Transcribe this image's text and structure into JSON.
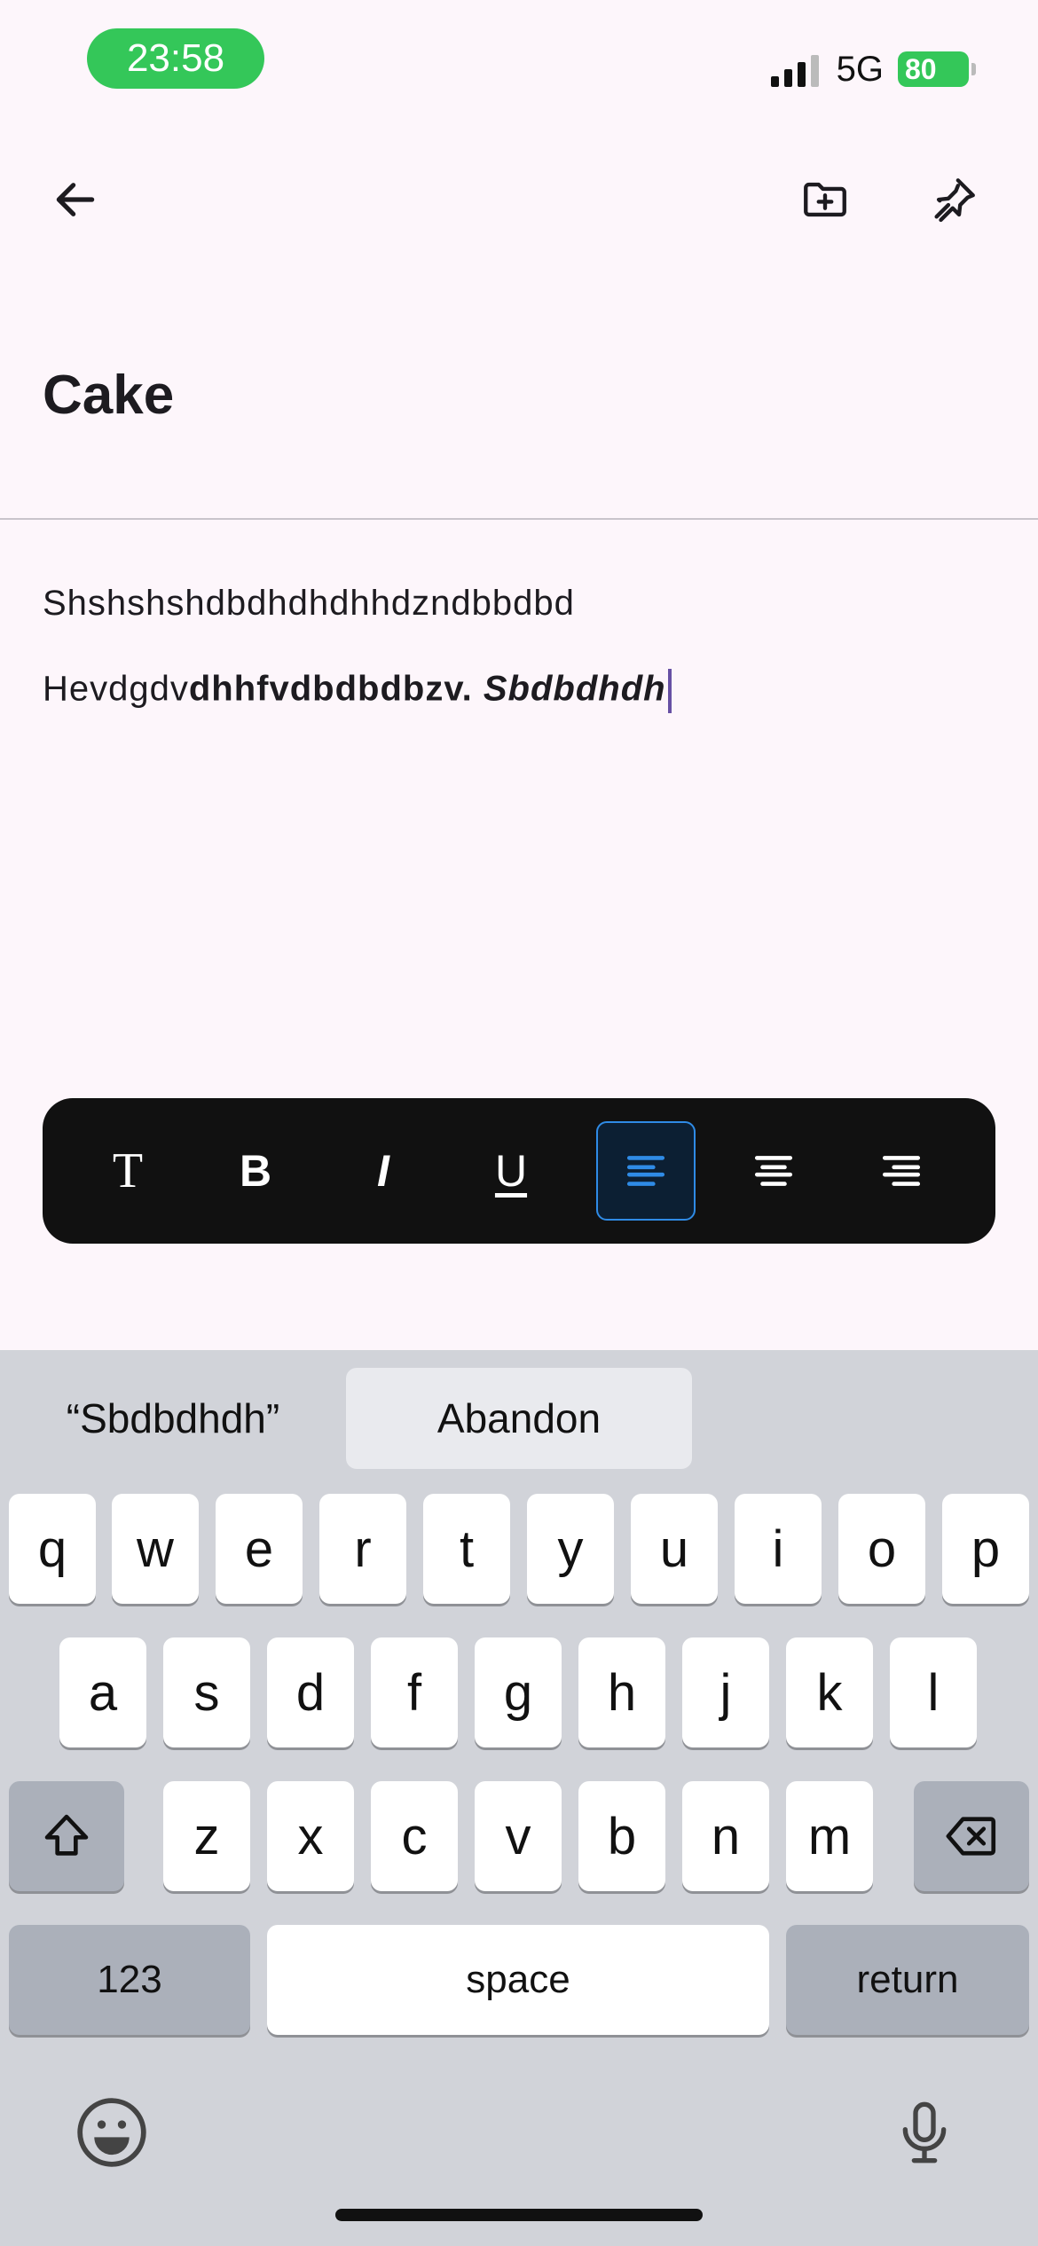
{
  "status_bar": {
    "time": "23:58",
    "network": "5G",
    "battery": "80"
  },
  "note": {
    "title": "Cake",
    "line1": "Shshshshdbdhdhdhhdzndbbdbd",
    "line2_regular": "Hevdgdv",
    "line2_bold": "dhhfvdbdbdbzv.",
    "line2_bold_italic": "Sbdbdhdh"
  },
  "format_toolbar": {
    "text_style_label": "T",
    "bold_label": "B",
    "italic_label": "I",
    "underline_label": "U",
    "active_alignment": "left"
  },
  "keyboard": {
    "suggestions": [
      "“Sbdbdhdh”",
      "Abandon"
    ],
    "row1": [
      "q",
      "w",
      "e",
      "r",
      "t",
      "y",
      "u",
      "i",
      "o",
      "p"
    ],
    "row2": [
      "a",
      "s",
      "d",
      "f",
      "g",
      "h",
      "j",
      "k",
      "l"
    ],
    "row3": [
      "z",
      "x",
      "c",
      "v",
      "b",
      "n",
      "m"
    ],
    "numbers_label": "123",
    "space_label": "space",
    "return_label": "return"
  },
  "icons": [
    "back-arrow-icon",
    "folder-add-icon",
    "pin-icon",
    "shift-icon",
    "delete-icon",
    "emoji-icon",
    "microphone-icon"
  ],
  "colors": {
    "accent": "#2f8be6",
    "status_green": "#34c759",
    "background": "#fdf6fb"
  }
}
